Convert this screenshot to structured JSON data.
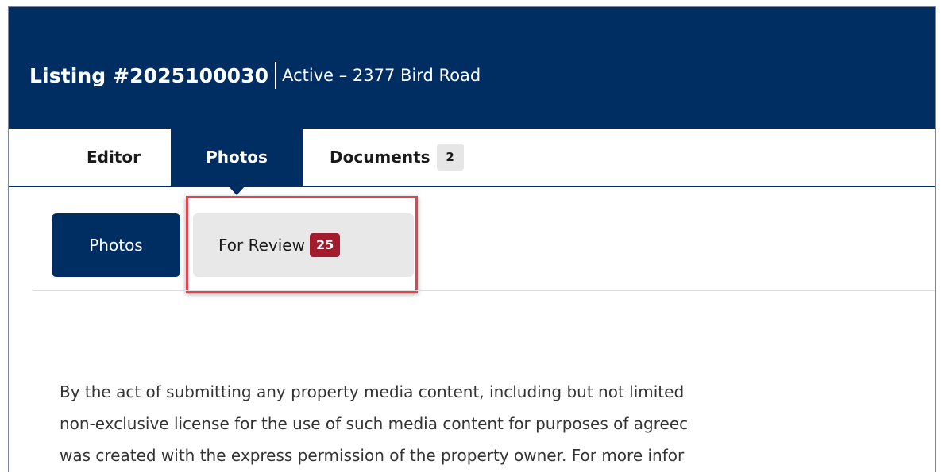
{
  "header": {
    "listing_id": "Listing #2025100030",
    "listing_status": "Active – 2377 Bird Road",
    "bg_color": "#002d62"
  },
  "tabs": [
    {
      "label": "Editor"
    },
    {
      "label": "Photos",
      "active": true
    },
    {
      "label": "Documents",
      "badge": "2"
    }
  ],
  "subtabs": [
    {
      "label": "Photos",
      "active": true
    },
    {
      "label": "For Review",
      "badge": "25",
      "badge_color": "#a31c2e",
      "highlighted": true
    }
  ],
  "notice": {
    "lines": [
      "By the act of submitting any property media content, including but not limited",
      "non-exclusive license for the use of such media content for purposes of agreec",
      "was created with the express permission of the property owner. For more infor"
    ]
  },
  "highlight_color": "#e0454f"
}
